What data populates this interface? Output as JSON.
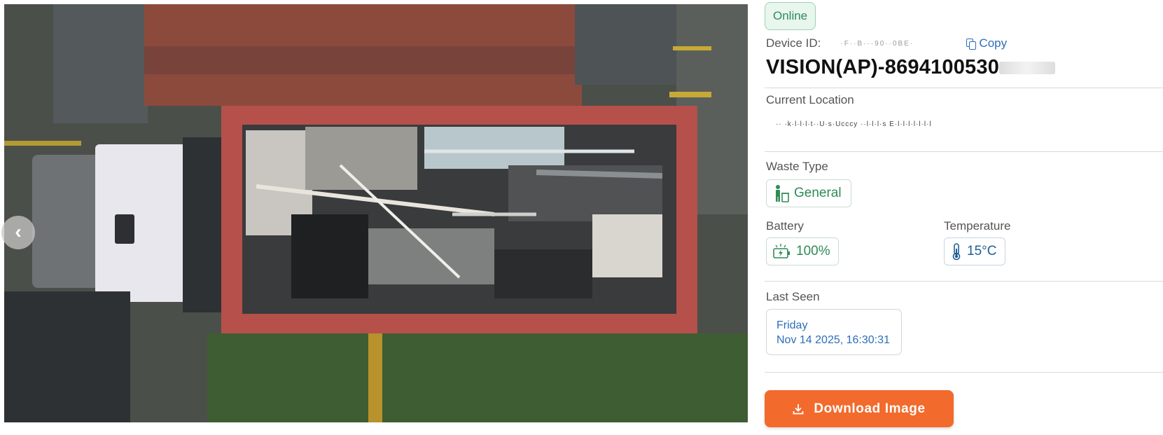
{
  "status": "Online",
  "device": {
    "id_label": "Device ID:",
    "id_value": "·F··B···90··0BE·",
    "copy_label": "Copy",
    "name": "VISION(AP)-8694100530"
  },
  "location": {
    "label": "Current Location",
    "value": "·· ·k·l·l·l·t··U·s·Ucccy  ··l·l·l·s E·l·l·l·l·l·l·l"
  },
  "waste": {
    "label": "Waste Type",
    "value": "General",
    "icon": "person-bin-icon"
  },
  "battery": {
    "label": "Battery",
    "value": "100%",
    "icon": "battery-charging-icon"
  },
  "temperature": {
    "label": "Temperature",
    "value": "15°C",
    "icon": "thermometer-icon"
  },
  "last_seen": {
    "label": "Last Seen",
    "day": "Friday",
    "datetime": "Nov 14 2025, 16:30:31"
  },
  "download": {
    "label": "Download Image",
    "icon": "download-icon"
  },
  "colors": {
    "accent_orange": "#f26a2c",
    "online_green": "#2e8b57",
    "link_blue": "#2c6fb8"
  }
}
